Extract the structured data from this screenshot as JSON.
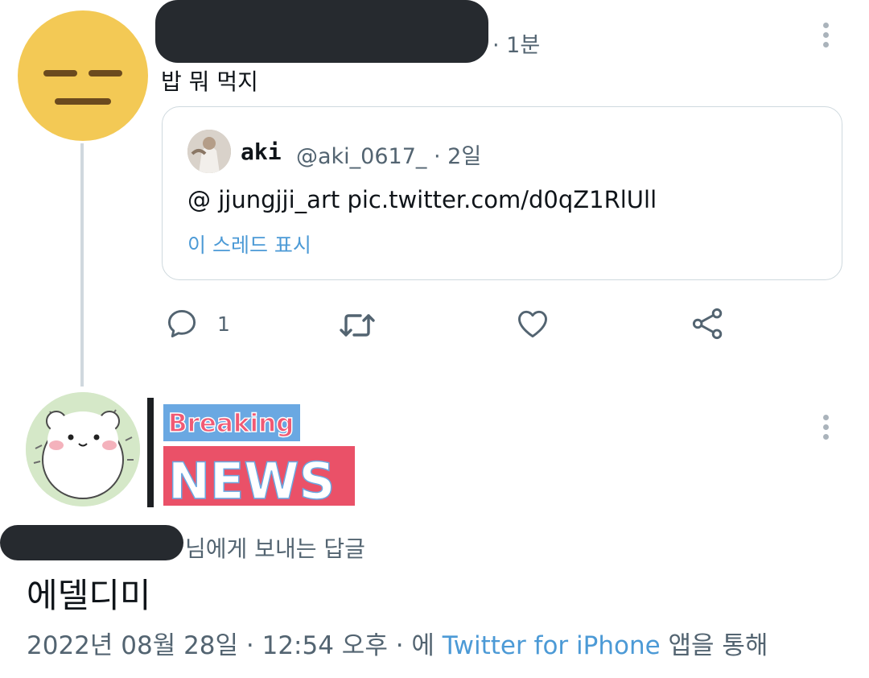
{
  "tweet1": {
    "time": "· 1분",
    "text": "밥 뭐 먹지",
    "quote": {
      "name": "aki",
      "handle": "@aki_0617_ · 2일",
      "text": "@ jjungjji_art pic.twitter.com/d0qZ1RlUll",
      "thread_link": "이 스레드 표시"
    },
    "actions": {
      "reply_count": "1"
    }
  },
  "tweet2": {
    "media": {
      "top_label": "Breaking",
      "bottom_label": "NEWS"
    },
    "reply_to_suffix": "님에게 보내는 답글",
    "text": "에델디미",
    "meta": {
      "timestamp": "2022년 08월 28일 · 12:54 오후 · 에 ",
      "source": "Twitter for iPhone",
      "suffix": " 앱을 통해"
    }
  },
  "colors": {
    "link": "#4c9ad6",
    "muted": "#536471",
    "news_red": "#ea5168",
    "breaking_blue": "#6aa8e2"
  }
}
